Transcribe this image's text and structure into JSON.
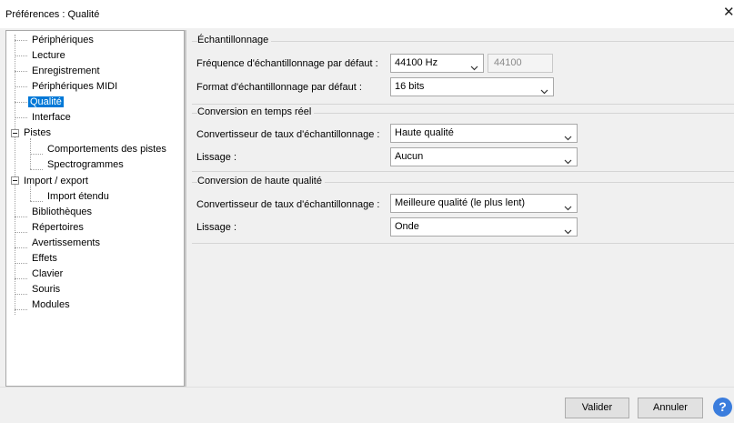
{
  "window": {
    "title": "Préférences : Qualité"
  },
  "tree": {
    "items": [
      {
        "label": "Périphériques"
      },
      {
        "label": "Lecture"
      },
      {
        "label": "Enregistrement"
      },
      {
        "label": "Périphériques MIDI"
      },
      {
        "label": "Qualité",
        "selected": true
      },
      {
        "label": "Interface"
      },
      {
        "label": "Pistes",
        "expanded": true
      },
      {
        "label": "Comportements des pistes"
      },
      {
        "label": "Spectrogrammes"
      },
      {
        "label": "Import / export",
        "expanded": true
      },
      {
        "label": "Import étendu"
      },
      {
        "label": "Bibliothèques"
      },
      {
        "label": "Répertoires"
      },
      {
        "label": "Avertissements"
      },
      {
        "label": "Effets"
      },
      {
        "label": "Clavier"
      },
      {
        "label": "Souris"
      },
      {
        "label": "Modules"
      }
    ]
  },
  "sampling": {
    "legend": "Échantillonnage",
    "rate_label": "Fréquence d'échantillonnage par défaut :",
    "rate_value": "44100 Hz",
    "rate_custom": "44100",
    "format_label": "Format d'échantillonnage par défaut :",
    "format_value": "16 bits"
  },
  "realtime": {
    "legend": "Conversion en temps réel",
    "converter_label": "Convertisseur de taux d'échantillonnage :",
    "converter_value": "Haute qualité",
    "dither_label": "Lissage :",
    "dither_value": "Aucun"
  },
  "highquality": {
    "legend": "Conversion de haute qualité",
    "converter_label": "Convertisseur de taux d'échantillonnage :",
    "converter_value": "Meilleure qualité (le plus lent)",
    "dither_label": "Lissage :",
    "dither_value": "Onde"
  },
  "buttons": {
    "ok": "Valider",
    "cancel": "Annuler",
    "help": "?"
  },
  "icons": {
    "close": "close-icon",
    "dropdown": "chevron-down-icon",
    "help": "help-icon"
  },
  "colors": {
    "selection": "#0078d7",
    "help": "#3b7ddd"
  }
}
